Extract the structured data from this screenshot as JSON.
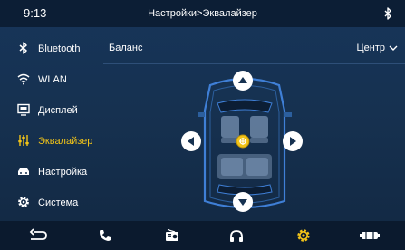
{
  "status": {
    "time": "9:13",
    "title": "Настройки>Эквалайзер",
    "icon": "bluetooth-icon"
  },
  "sidebar": {
    "items": [
      {
        "label": "Bluetooth",
        "icon": "bluetooth-icon",
        "active": false
      },
      {
        "label": "WLAN",
        "icon": "wifi-icon",
        "active": false
      },
      {
        "label": "Дисплей",
        "icon": "display-icon",
        "active": false
      },
      {
        "label": "Эквалайзер",
        "icon": "equalizer-icon",
        "active": true
      },
      {
        "label": "Настройка",
        "icon": "car-icon",
        "active": false
      },
      {
        "label": "Система",
        "icon": "gear-icon",
        "active": false
      }
    ]
  },
  "main": {
    "balance_label": "Баланс",
    "balance_value": "Центр"
  },
  "bottom_bar": {
    "buttons": [
      "back-icon",
      "phone-icon",
      "radio-icon",
      "headphones-icon",
      "settings-icon",
      "car-icon"
    ],
    "active": "settings-icon"
  },
  "colors": {
    "accent": "#f2c418",
    "background": "#163150",
    "car_outline": "#3f7fd6"
  }
}
